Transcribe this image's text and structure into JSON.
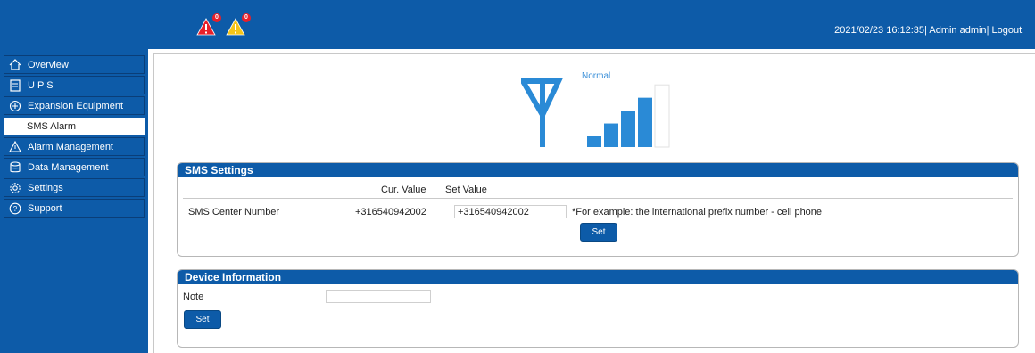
{
  "header": {
    "alarms": [
      {
        "name": "critical-alarm",
        "count": "0",
        "color": "#e8202a"
      },
      {
        "name": "warning-alarm",
        "count": "0",
        "color": "#f5c518"
      }
    ],
    "datetime": "2021/02/23 16:12:35",
    "user_label": "Admin admin",
    "logout_label": "Logout"
  },
  "sidebar": {
    "items": [
      {
        "label": "Overview",
        "icon": "home-icon"
      },
      {
        "label": "U P S",
        "icon": "ups-icon"
      },
      {
        "label": "Expansion Equipment",
        "icon": "expansion-icon"
      },
      {
        "label": "Alarm Management",
        "icon": "alarm-icon"
      },
      {
        "label": "Data Management",
        "icon": "database-icon"
      },
      {
        "label": "Settings",
        "icon": "gear-icon"
      },
      {
        "label": "Support",
        "icon": "help-icon"
      }
    ],
    "sub_items": [
      {
        "label": "SMS Alarm"
      }
    ]
  },
  "signal": {
    "status": "Normal",
    "level": 4,
    "max_level": 5,
    "accent": "#2a8ad6"
  },
  "sms_settings": {
    "title": "SMS Settings",
    "col_current": "Cur. Value",
    "col_set": "Set Value",
    "rows": [
      {
        "label": "SMS Center Number",
        "current": "+316540942002",
        "set_value": "+316540942002",
        "hint": "*For example: the international prefix number - cell phone"
      }
    ],
    "set_button": "Set"
  },
  "device_info": {
    "title": "Device Information",
    "note_label": "Note",
    "note_value": "",
    "set_button": "Set"
  }
}
